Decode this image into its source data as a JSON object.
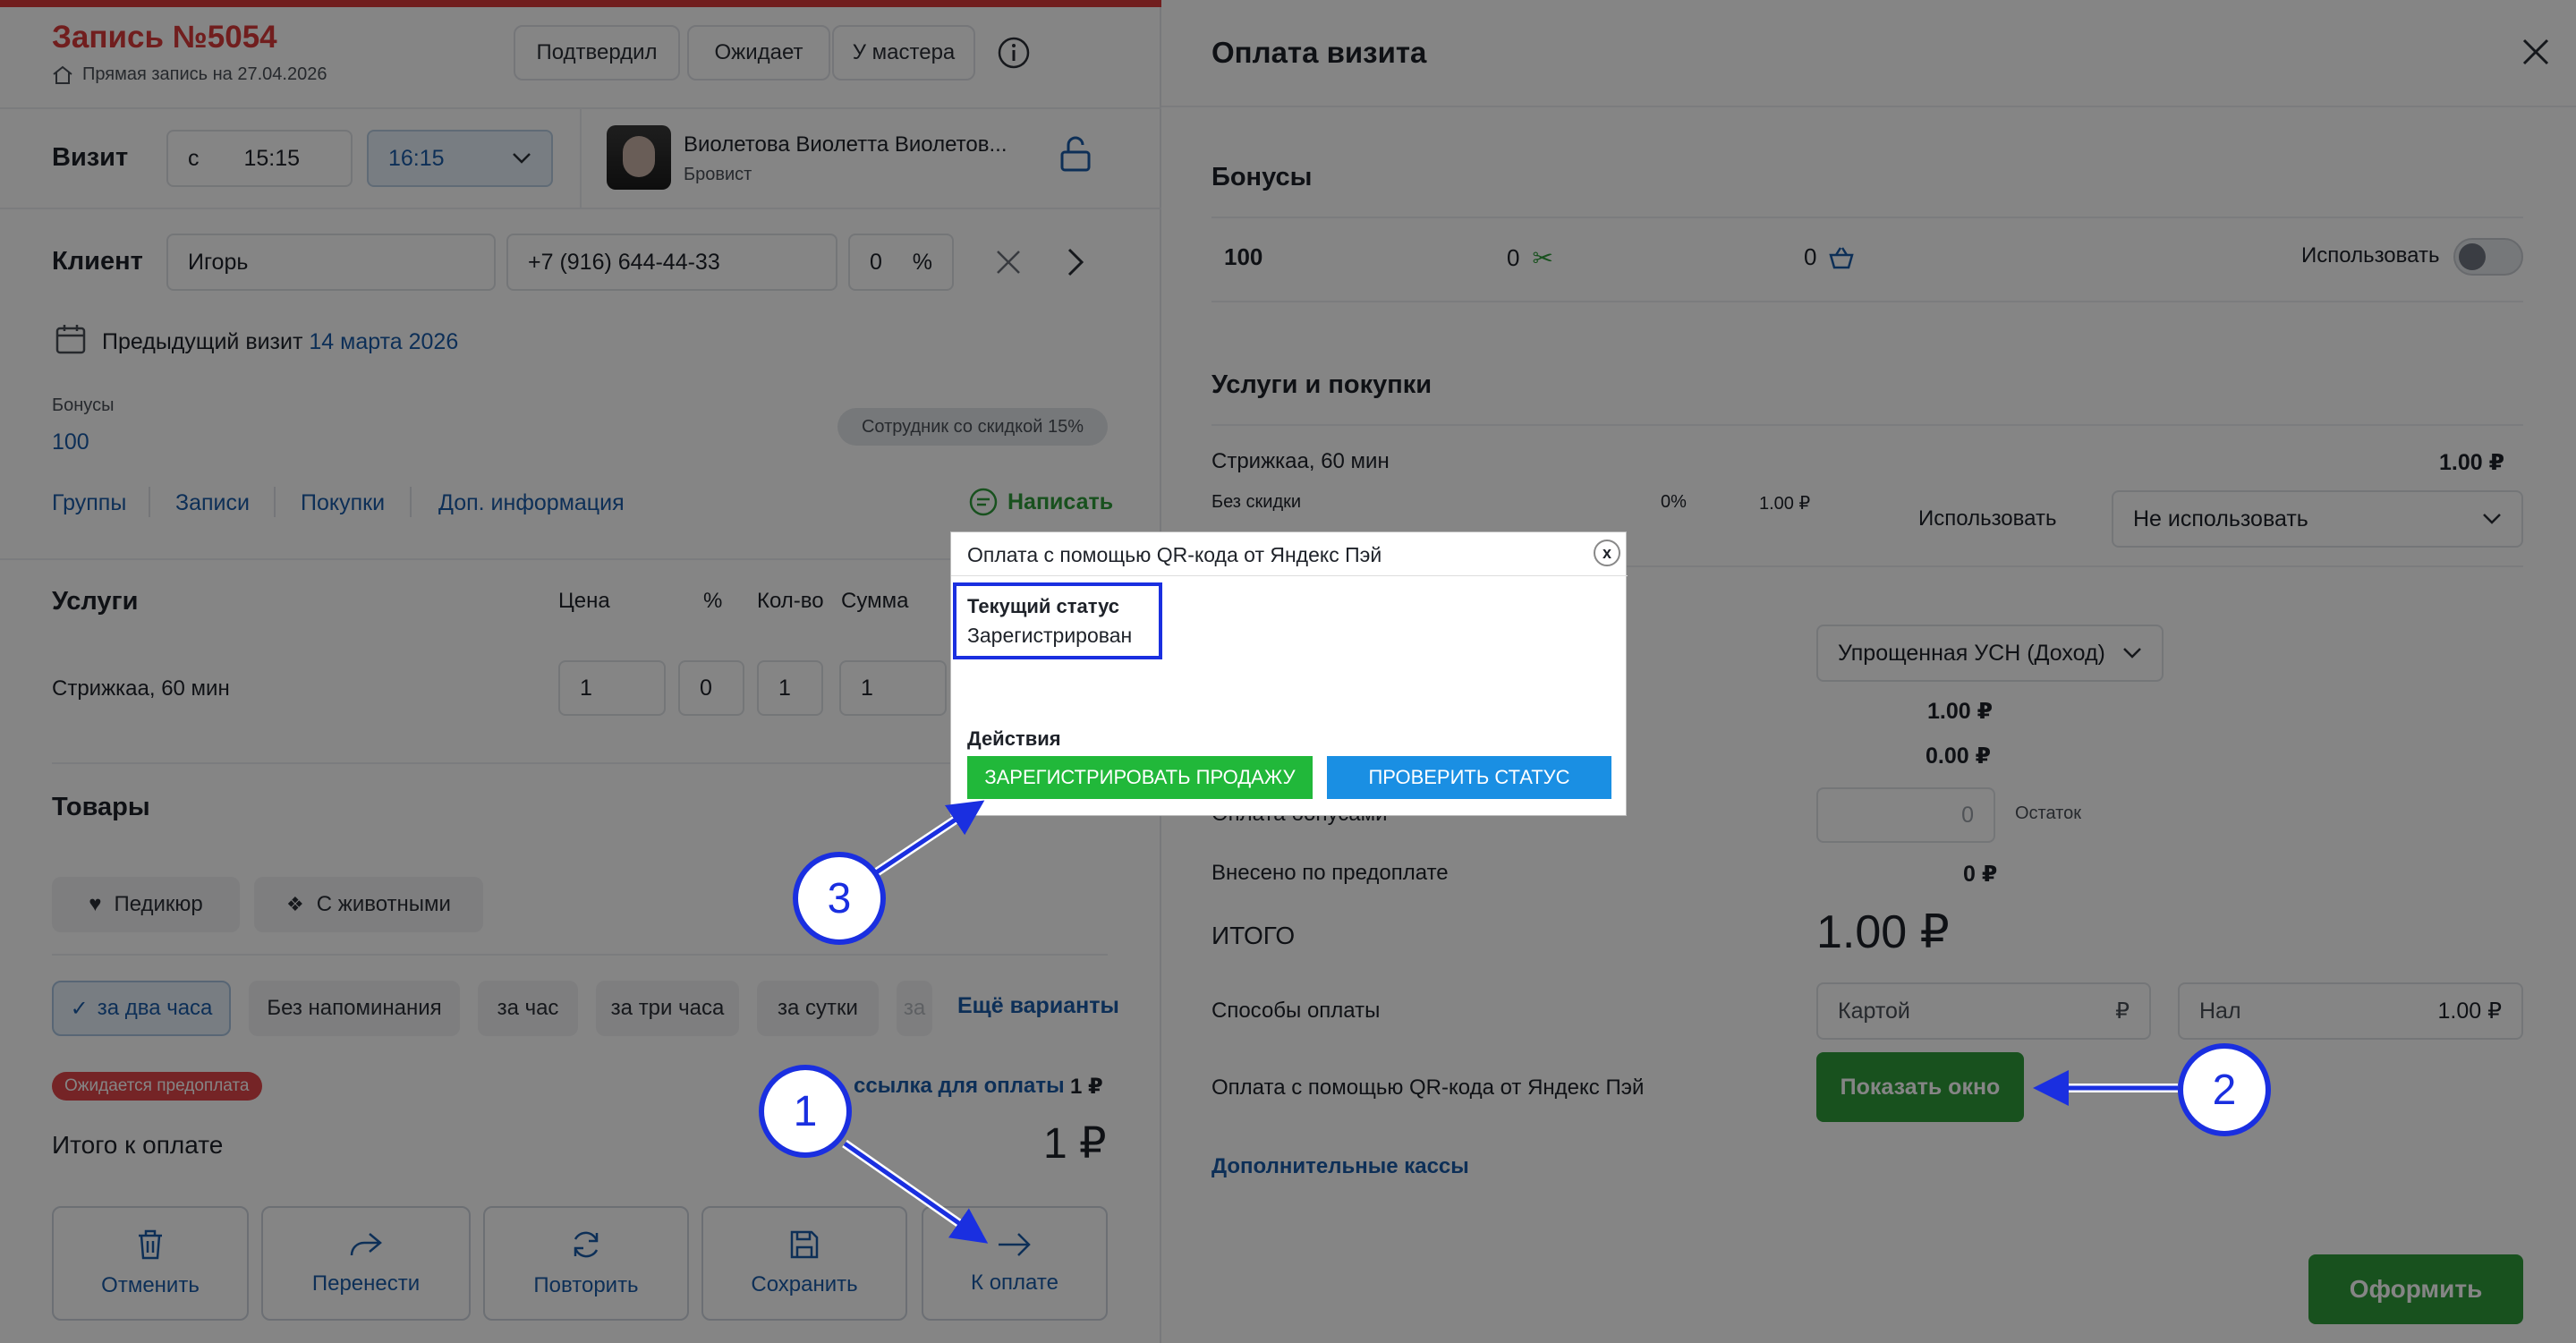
{
  "record": {
    "title": "Запись №5054",
    "subtitle": "Прямая запись на 27.04.2026",
    "status_buttons": [
      "Подтвердил",
      "Ожидает",
      "У мастера"
    ]
  },
  "visit": {
    "label": "Визит",
    "from_prefix": "с",
    "start_time": "15:15",
    "end_time": "16:15",
    "master_name": "Виолетова Виолетта Виолетов...",
    "master_role": "Бровист"
  },
  "client": {
    "label": "Клиент",
    "name": "Игорь",
    "phone": "+7 (916) 644-44-33",
    "discount": "0",
    "discount_unit": "%",
    "prev_visit_label": "Предыдущий визит",
    "prev_visit_date": "14 марта 2026",
    "bonuses_label": "Бонусы",
    "bonuses_value": "100",
    "badge": "Сотрудник со скидкой 15%",
    "tabs": [
      "Группы",
      "Записи",
      "Покупки",
      "Доп. информация"
    ],
    "write_label": "Написать"
  },
  "services": {
    "label": "Услуги",
    "columns": [
      "Цена",
      "%",
      "Кол-во",
      "Сумма"
    ],
    "rows": [
      {
        "name": "Стрижкаа, 60 мин",
        "price": "1",
        "percent": "0",
        "qty": "1",
        "sum": "1"
      }
    ]
  },
  "goods": {
    "label": "Товары",
    "tags": [
      "Педикюр",
      "С животными"
    ]
  },
  "reminders": {
    "options": [
      "за два часа",
      "Без напоминания",
      "за час",
      "за три часа",
      "за сутки",
      "за"
    ],
    "more_label": "Ещё варианты"
  },
  "payment_left": {
    "badge": "Ожидается предоплата",
    "link_label": "ссылка для оплаты",
    "link_amount": "1 ₽",
    "total_label": "Итого к оплате",
    "total_value": "1 ₽"
  },
  "actions": [
    "Отменить",
    "Перенести",
    "Повторить",
    "Сохранить",
    "К оплате"
  ],
  "payment_panel": {
    "title": "Оплата визита",
    "bonuses_heading": "Бонусы",
    "bonus_total": "100",
    "bonus_services": "0",
    "bonus_goods": "0",
    "use_label": "Использовать",
    "services_heading": "Услуги и покупки",
    "service_name": "Стрижкаа, 60 мин",
    "service_amount": "1.00 ₽",
    "no_discount": "Без скидки",
    "discount_pct": "0%",
    "discount_sum": "1.00 ₽",
    "use_label2": "Использовать",
    "use_select": "Не использовать",
    "tax_select": "Упрощенная УСН (Доход)",
    "sum1": "1.00 ₽",
    "sum2": "0.00 ₽",
    "bonus_pay_label": "Оплата бонусами",
    "bonus_pay_value": "0",
    "remainder_label": "Остаток",
    "prepaid_label": "Внесено по предоплате",
    "prepaid_value": "0 ₽",
    "total_label": "ИТОГО",
    "total_value": "1.00 ₽",
    "methods_label": "Способы оплаты",
    "card_label": "Картой",
    "card_currency": "₽",
    "cash_label": "Нал",
    "cash_value": "1.00 ₽",
    "qr_label": "Оплата с помощью QR-кода от Яндекс Пэй",
    "show_window": "Показать окно",
    "extra_cash": "Дополнительные кассы",
    "submit": "Оформить"
  },
  "dialog": {
    "title": "Оплата с помощью QR-кода от Яндекс Пэй",
    "close": "x",
    "status_heading": "Текущий статус",
    "status_value": "Зарегистрирован",
    "actions_heading": "Действия",
    "register_button": "ЗАРЕГИСТРИРОВАТЬ ПРОДАЖУ",
    "check_button": "ПРОВЕРИТЬ СТАТУС"
  },
  "callouts": [
    "1",
    "2",
    "3"
  ],
  "colors": {
    "accent_red": "#d93b3b",
    "link_blue": "#1a5ba8",
    "green": "#2e9b3a",
    "callout_blue": "#1a2fe0",
    "dialog_blue": "#1a8fe3"
  }
}
